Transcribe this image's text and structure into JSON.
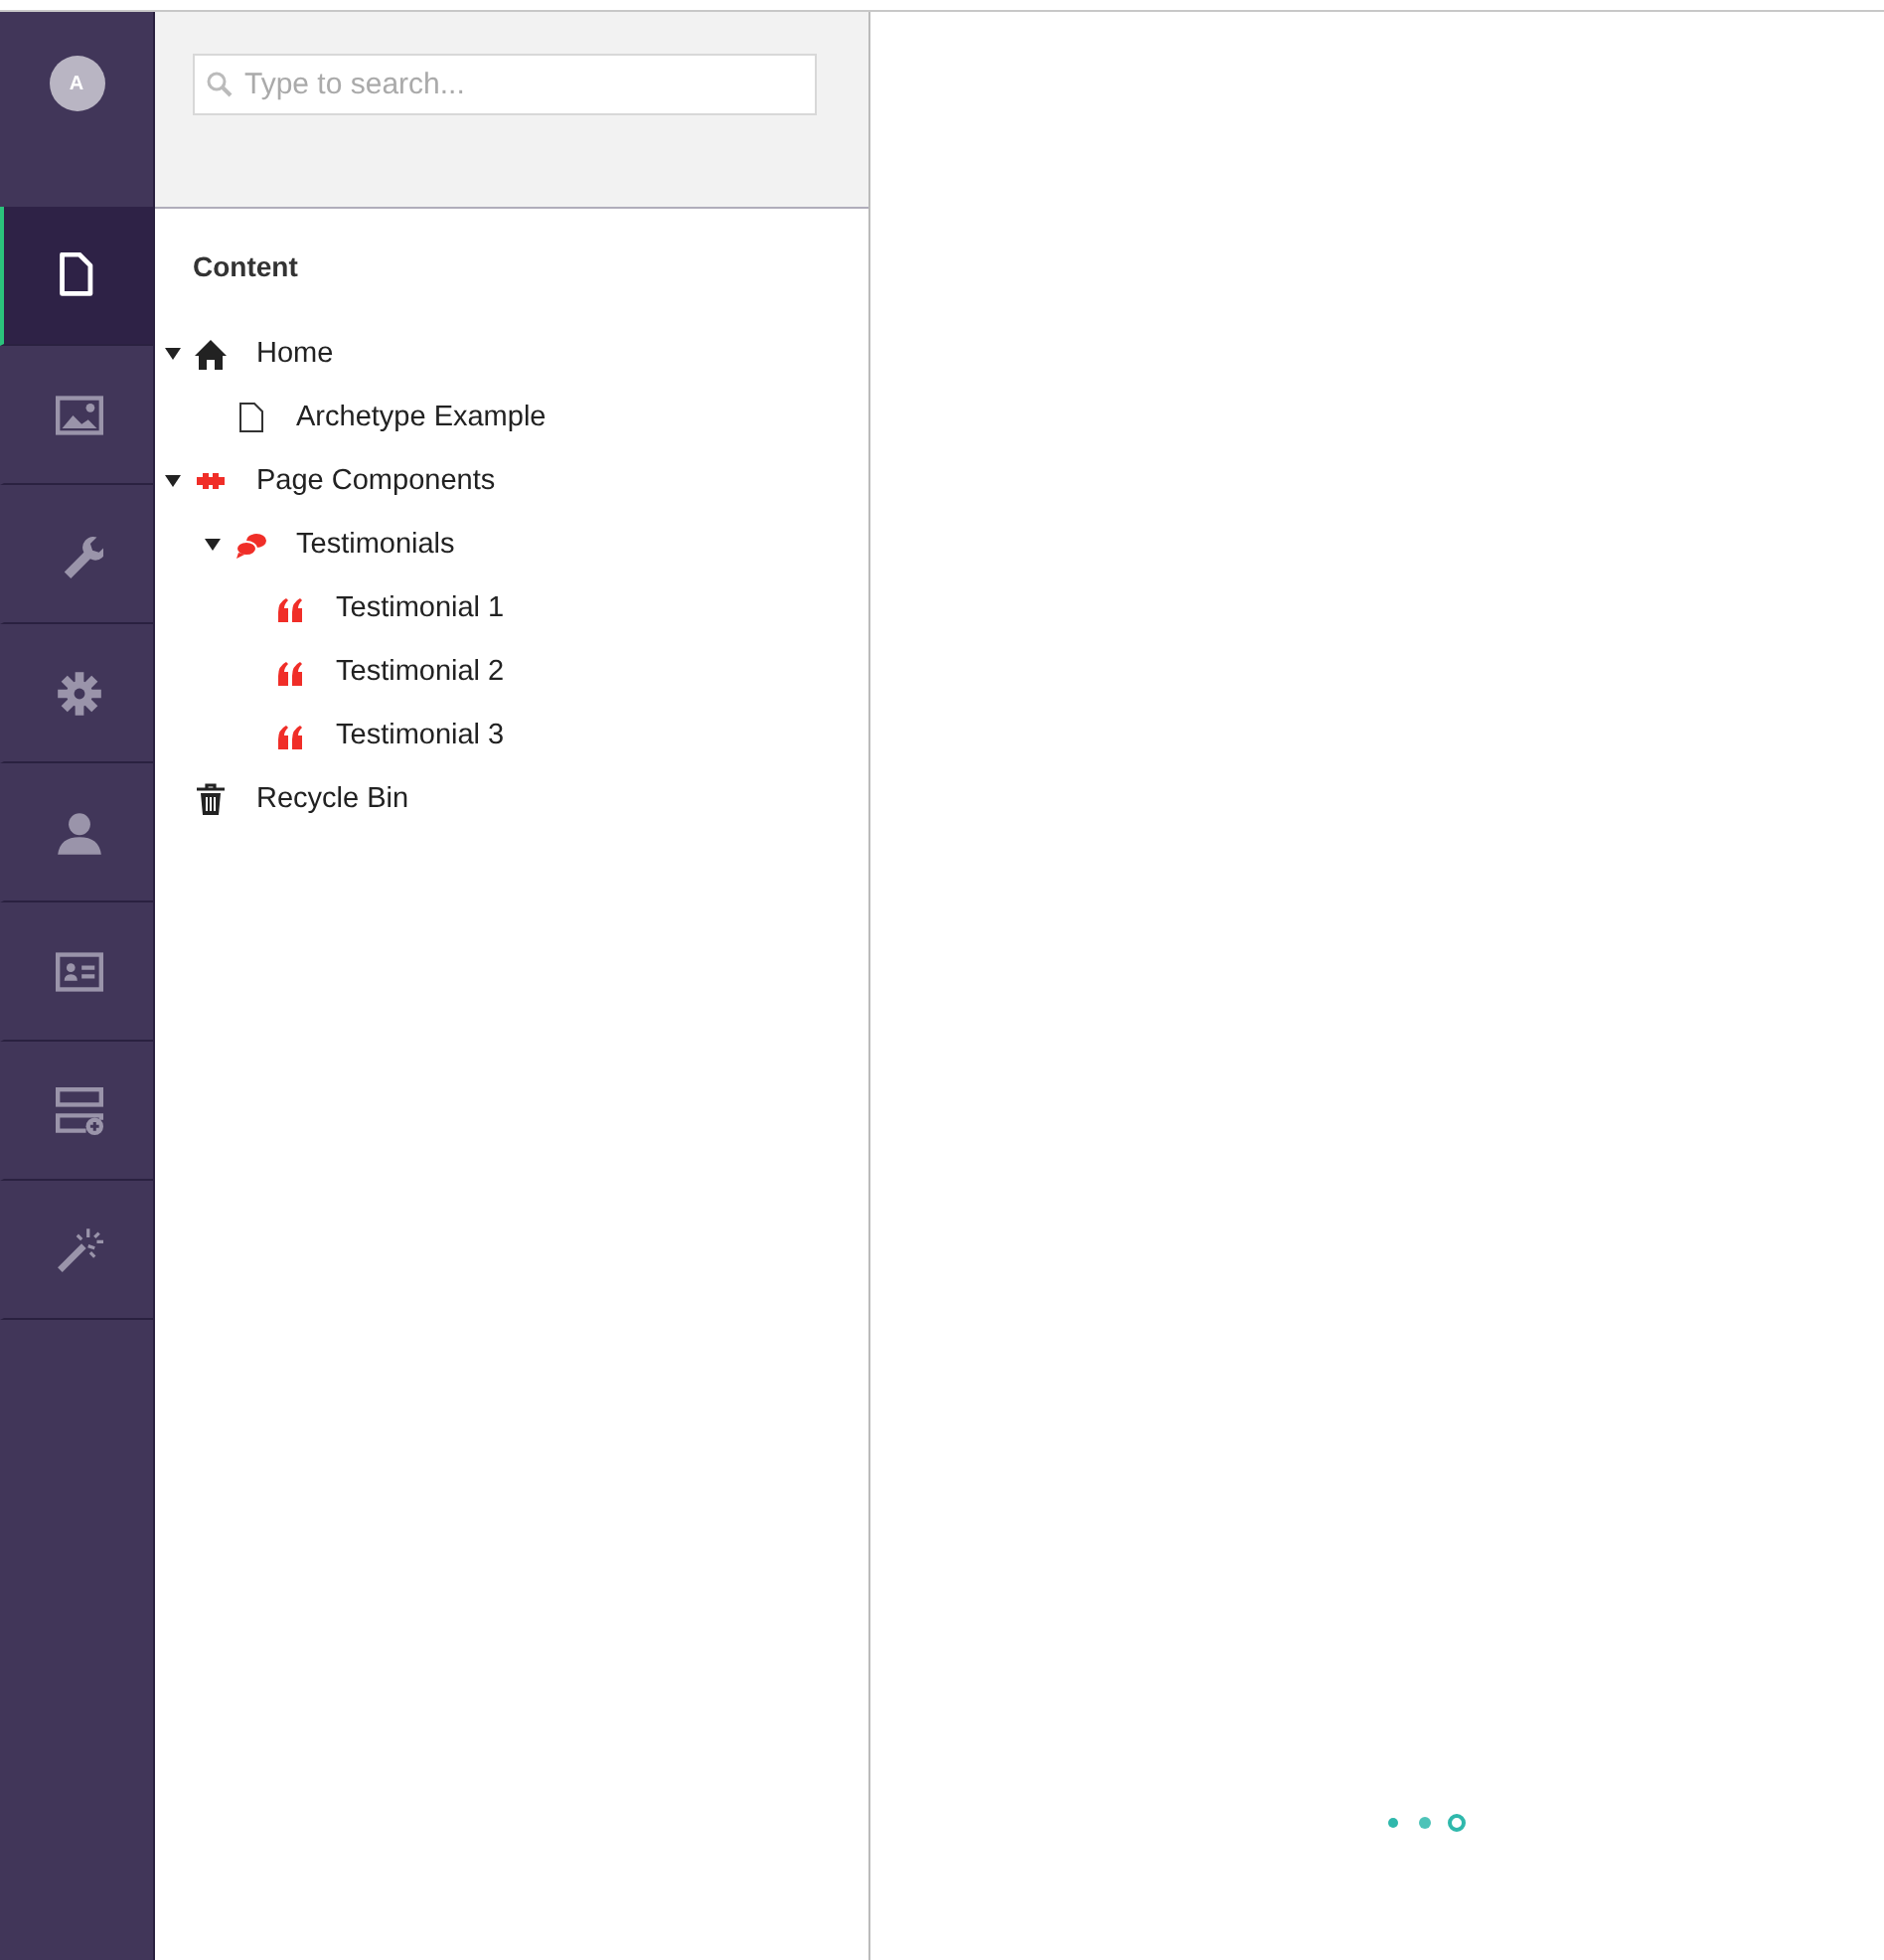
{
  "user": {
    "initial": "A"
  },
  "sections": [
    {
      "kind": "content",
      "selected": true
    },
    {
      "kind": "media",
      "selected": false
    },
    {
      "kind": "settings",
      "selected": false
    },
    {
      "kind": "developer",
      "selected": false
    },
    {
      "kind": "users",
      "selected": false
    },
    {
      "kind": "members",
      "selected": false
    },
    {
      "kind": "forms",
      "selected": false
    },
    {
      "kind": "magic",
      "selected": false
    }
  ],
  "search": {
    "placeholder": "Type to search..."
  },
  "tree": {
    "title": "Content",
    "nodes": [
      {
        "label": "Home",
        "kind": "home",
        "expanded": true,
        "children": [
          {
            "label": "Archetype Example",
            "kind": "page"
          }
        ]
      },
      {
        "label": "Page Components",
        "kind": "components",
        "expanded": true,
        "children": [
          {
            "label": "Testimonials",
            "kind": "folder",
            "expanded": true,
            "children": [
              {
                "label": "Testimonial 1",
                "kind": "quote"
              },
              {
                "label": "Testimonial 2",
                "kind": "quote"
              },
              {
                "label": "Testimonial 3",
                "kind": "quote"
              }
            ]
          }
        ]
      },
      {
        "label": "Recycle Bin",
        "kind": "bin"
      }
    ]
  }
}
